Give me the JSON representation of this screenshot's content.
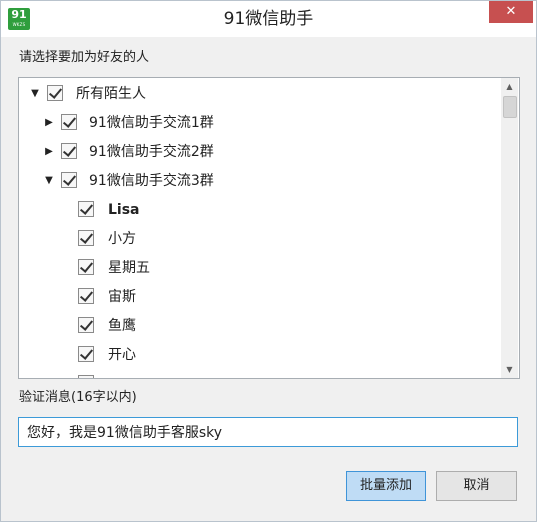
{
  "window": {
    "title": "91微信助手"
  },
  "app_logo": {
    "number": "91",
    "subtext": "WKZS",
    "color": "#2f9e3d"
  },
  "close_button": {
    "symbol": "✕",
    "color": "#c75050"
  },
  "prompt": {
    "label": "请选择要加为好友的人"
  },
  "tree": {
    "root": {
      "label": "所有陌生人",
      "checked": true,
      "expanded": true
    },
    "groups": [
      {
        "label": "91微信助手交流1群",
        "checked": true,
        "expanded": false
      },
      {
        "label": "91微信助手交流2群",
        "checked": true,
        "expanded": false
      },
      {
        "label": "91微信助手交流3群",
        "checked": true,
        "expanded": true
      }
    ],
    "members": [
      {
        "label": "Lisa",
        "checked": true
      },
      {
        "label": "小方",
        "checked": true
      },
      {
        "label": "星期五",
        "checked": true
      },
      {
        "label": "宙斯",
        "checked": true
      },
      {
        "label": "鱼鹰",
        "checked": true
      },
      {
        "label": "开心",
        "checked": true
      }
    ]
  },
  "verify": {
    "label": "验证消息(16字以内)",
    "value": "您好，我是91微信助手客服sky"
  },
  "buttons": {
    "batch_add": "批量添加",
    "cancel": "取消"
  },
  "colors": {
    "accent": "#3f94d8",
    "primary_button_bg": "#bfdcf5"
  }
}
